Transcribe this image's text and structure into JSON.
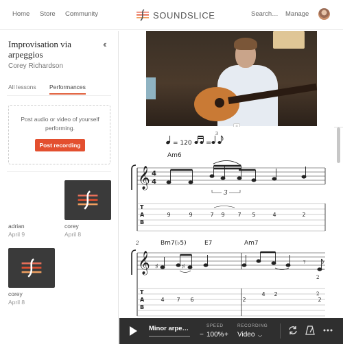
{
  "nav": {
    "home": "Home",
    "store": "Store",
    "community": "Community",
    "search": "Search…",
    "manage": "Manage",
    "brand": "SOUNDSLICE"
  },
  "sidebar": {
    "title": "Improvisation via arpeggios",
    "author": "Corey Richardson",
    "collapse": "‹‹",
    "tabs": [
      {
        "label": "All lessons"
      },
      {
        "label": "Performances"
      }
    ],
    "upload_text": "Post audio or video of yourself performing.",
    "post_button": "Post recording",
    "performances": [
      {
        "name": "adrian",
        "date": "April 9",
        "thumb": "video"
      },
      {
        "name": "corey",
        "date": "April 8",
        "thumb": "logo"
      },
      {
        "name": "corey",
        "date": "April 8",
        "thumb": "logo"
      }
    ]
  },
  "score": {
    "tempo": "= 120",
    "swing_equals": "=",
    "swing_triplet": "3",
    "chords_sys1": [
      "Am6"
    ],
    "chords_sys2": [
      "Bm7(♭5)",
      "E7",
      "Am7"
    ],
    "measure_number_2": "2",
    "triplet_mark": "3",
    "tab_sys1": [
      "9",
      "9",
      "7",
      "9",
      "7",
      "5",
      "4",
      "2"
    ],
    "tab_sys2": [
      "4",
      "7",
      "6",
      "2",
      "4",
      "2",
      "2"
    ],
    "tab_letters": [
      "T",
      "A",
      "B"
    ],
    "time_signature": [
      "4",
      "4"
    ]
  },
  "player": {
    "title": "Minor arpe…",
    "speed_label": "SPEED",
    "speed_value": "100%",
    "speed_minus": "−",
    "speed_plus": "+",
    "recording_label": "RECORDING",
    "recording_value": "Video",
    "recording_caret": "⌵"
  },
  "colors": {
    "accent": "#e34f2f",
    "player_bg": "#2f2f2f"
  },
  "icons": {
    "loop": "loop-icon",
    "metronome": "metronome-icon",
    "more": "more-icon",
    "play": "play-icon"
  }
}
